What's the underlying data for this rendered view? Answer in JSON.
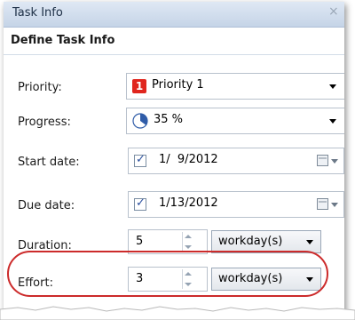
{
  "window": {
    "title": "Task Info",
    "close_glyph": "×"
  },
  "section": {
    "title": "Define Task Info"
  },
  "fields": {
    "priority": {
      "label": "Priority:",
      "badge": "1",
      "value": "Priority 1",
      "icon": "priority-flag-icon",
      "badge_color": "#e0261e"
    },
    "progress": {
      "label": "Progress:",
      "value": "35 %",
      "percent": 35,
      "icon": "progress-pie-icon"
    },
    "start_date": {
      "label": "Start date:",
      "value": "1/  9/2012",
      "checked": true
    },
    "due_date": {
      "label": "Due date:",
      "value": "1/13/2012",
      "checked": true
    },
    "duration": {
      "label": "Duration:",
      "value": "5",
      "unit": "workday(s)"
    },
    "effort": {
      "label": "Effort:",
      "value": "3",
      "unit": "workday(s)"
    }
  },
  "highlight": {
    "color": "#cc2b2b"
  }
}
